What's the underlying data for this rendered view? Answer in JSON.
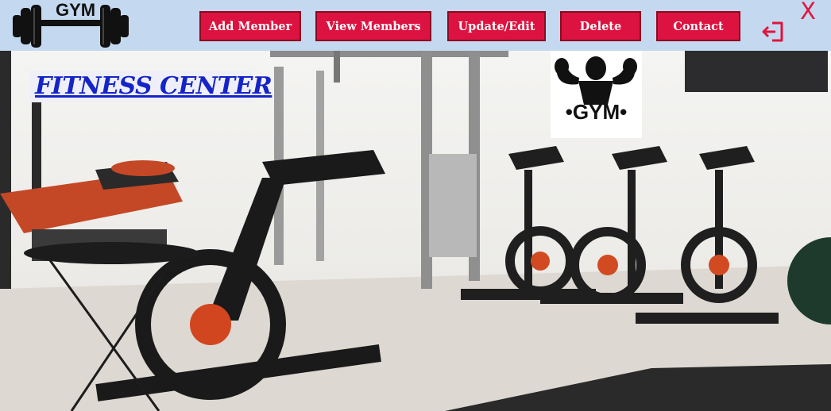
{
  "header": {
    "logo_text": "GYM",
    "buttons": [
      {
        "label": "Add Member"
      },
      {
        "label": "View Members"
      },
      {
        "label": "Update/Edit"
      },
      {
        "label": "Delete"
      },
      {
        "label": "Contact"
      }
    ],
    "logout_icon": "logout-icon",
    "close_label": "X"
  },
  "main": {
    "title": "FITNESS CENTER",
    "badge_text": "•GYM•"
  },
  "colors": {
    "toolbar_bg": "#c4d9f0",
    "button_bg": "#dc1340",
    "title_color": "#1524c8",
    "close_color": "#e0153e"
  }
}
